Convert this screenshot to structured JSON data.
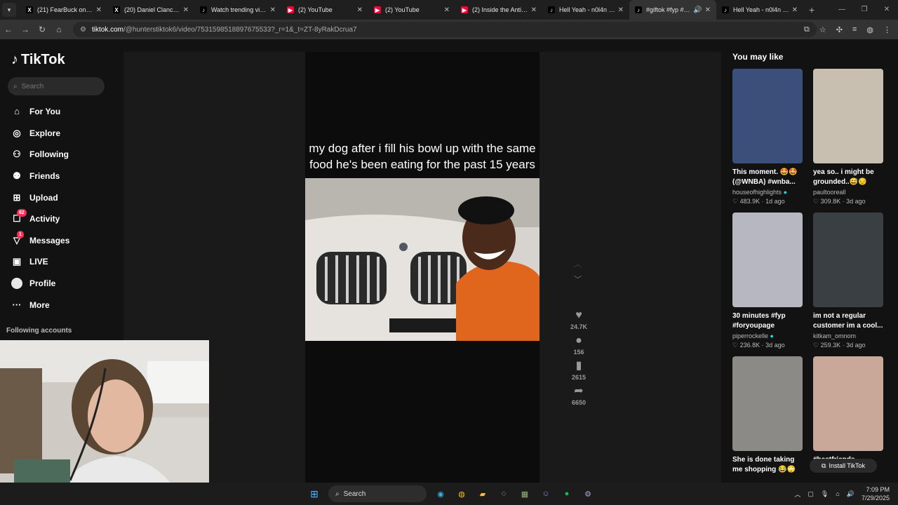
{
  "browser": {
    "tabs": [
      {
        "title": "(21) FearBuck on X: \"L",
        "icon": "x-logo-icon",
        "active": false
      },
      {
        "title": "(20) Daniel Clancy on",
        "icon": "x-logo-icon",
        "active": false
      },
      {
        "title": "Watch trending video",
        "icon": "tiktok-icon",
        "active": false
      },
      {
        "title": "(2) YouTube",
        "icon": "youtube-icon",
        "active": false
      },
      {
        "title": "(2) YouTube",
        "icon": "youtube-icon",
        "active": false
      },
      {
        "title": "(2) Inside the Anti-G",
        "icon": "youtube-icon",
        "active": false
      },
      {
        "title": "Hell Yeah - n0l4n Mu",
        "icon": "tiktok-icon",
        "active": false
      },
      {
        "title": "#giftok #fyp #tar",
        "icon": "tiktok-icon",
        "active": true
      },
      {
        "title": "Hell Yeah - n0l4n Mu",
        "icon": "tiktok-icon",
        "active": false
      }
    ],
    "url_host": "tiktok.com",
    "url_path": "/@hunterstiktok6/video/7531598518897675533?_r=1&_t=ZT-8yRakDcrua7"
  },
  "sidebar": {
    "logo": "TikTok",
    "search_placeholder": "Search",
    "items": [
      {
        "label": "For You",
        "icon": "home-icon",
        "glyph": "⌂"
      },
      {
        "label": "Explore",
        "icon": "compass-icon",
        "glyph": "◎"
      },
      {
        "label": "Following",
        "icon": "following-icon",
        "glyph": "⚇"
      },
      {
        "label": "Friends",
        "icon": "friends-icon",
        "glyph": "⚉"
      },
      {
        "label": "Upload",
        "icon": "upload-icon",
        "glyph": "⊞"
      },
      {
        "label": "Activity",
        "icon": "activity-icon",
        "glyph": "☐",
        "badge": "82"
      },
      {
        "label": "Messages",
        "icon": "messages-icon",
        "glyph": "▽",
        "badge": "1"
      },
      {
        "label": "LIVE",
        "icon": "live-icon",
        "glyph": "▣"
      },
      {
        "label": "Profile",
        "icon": "profile-icon",
        "glyph": ""
      },
      {
        "label": "More",
        "icon": "more-icon",
        "glyph": "···"
      }
    ],
    "following_accounts": "Following accounts"
  },
  "video": {
    "caption": "my dog after i fill his bowl up with the same food he's been eating for the past 15 years",
    "likes": "24.7K",
    "comments": "156",
    "saves": "2615",
    "shares": "6650"
  },
  "suggestions": {
    "heading": "You may like",
    "items": [
      {
        "title": "This moment. 🤩🤩 (@WNBA) #wnba...",
        "author": "houseofhighlights",
        "verified": true,
        "likes": "483.9K",
        "age": "1d ago",
        "bg": "#3b4f7a"
      },
      {
        "title": "yea so.. i might be grounded..😅😔",
        "author": "paultooreall",
        "verified": false,
        "likes": "309.8K",
        "age": "3d ago",
        "bg": "#c9bfb0"
      },
      {
        "title": "30 minutes #fyp #foryoupage",
        "author": "piperrockelle",
        "verified": true,
        "likes": "236.8K",
        "age": "3d ago",
        "bg": "#b7b7c2"
      },
      {
        "title": "im not a regular customer im a cool...",
        "author": "kitkam_omnom",
        "verified": false,
        "likes": "259.3K",
        "age": "3d ago",
        "bg": "#3a3f44"
      },
      {
        "title": "She is done taking me shopping 😂🙄",
        "author": "",
        "verified": false,
        "likes": "",
        "age": "",
        "bg": "#8c8a86"
      },
      {
        "title": "#bestfriends",
        "author": "",
        "verified": false,
        "likes": "",
        "age": "",
        "bg": "#c9a89a"
      }
    ],
    "install": "Install TikTok"
  },
  "taskbar": {
    "search": "Search",
    "time": "7:09 PM",
    "date": "7/29/2025"
  }
}
